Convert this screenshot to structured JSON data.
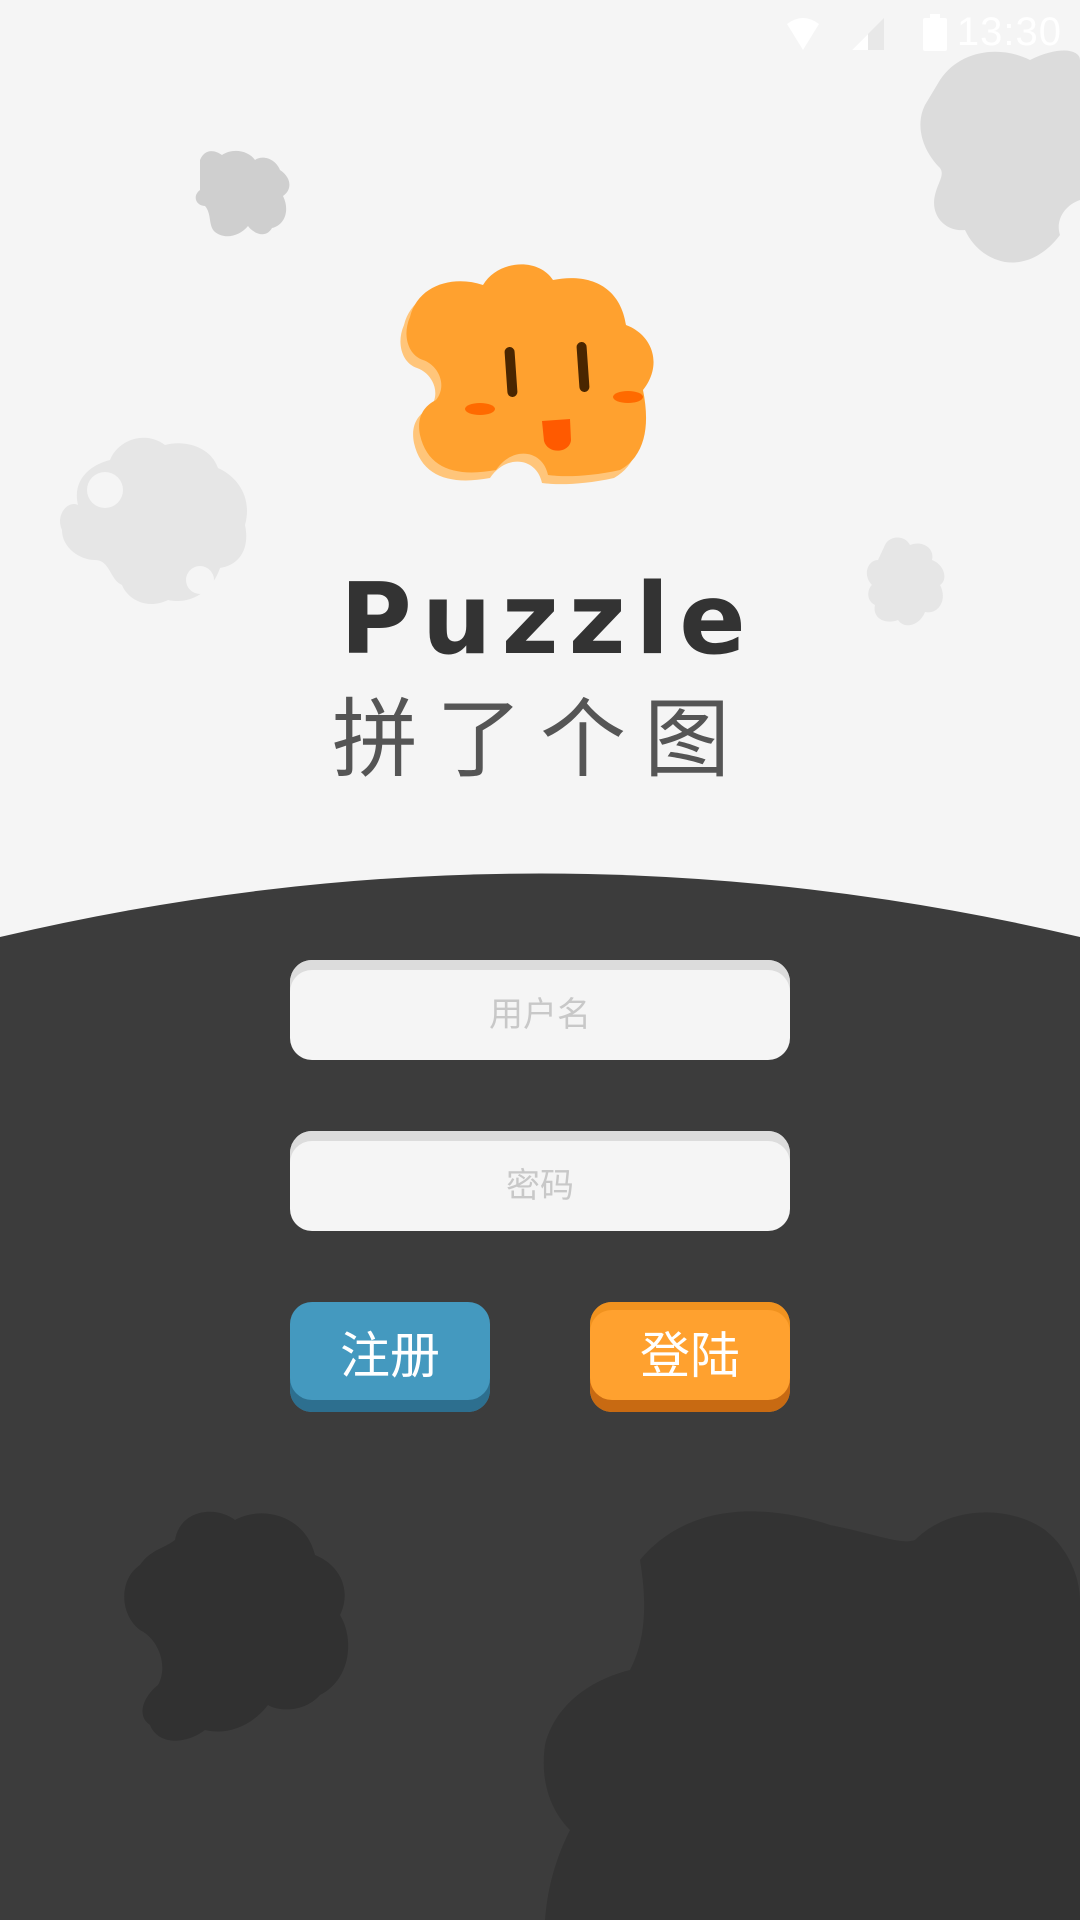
{
  "status_bar": {
    "time": "13:30",
    "icons": [
      "wifi-icon",
      "signal-icon",
      "battery-icon"
    ]
  },
  "app": {
    "title": "Puzzle",
    "subtitle": "拼了个图"
  },
  "login_form": {
    "username_placeholder": "用户名",
    "password_placeholder": "密码",
    "register_label": "注册",
    "login_label": "登陆"
  },
  "colors": {
    "background_light": "#f5f5f5",
    "background_dark": "#3c3c3c",
    "register_button": "#4499bf",
    "login_button": "#ffa12f",
    "mascot": "#ffa12f"
  }
}
